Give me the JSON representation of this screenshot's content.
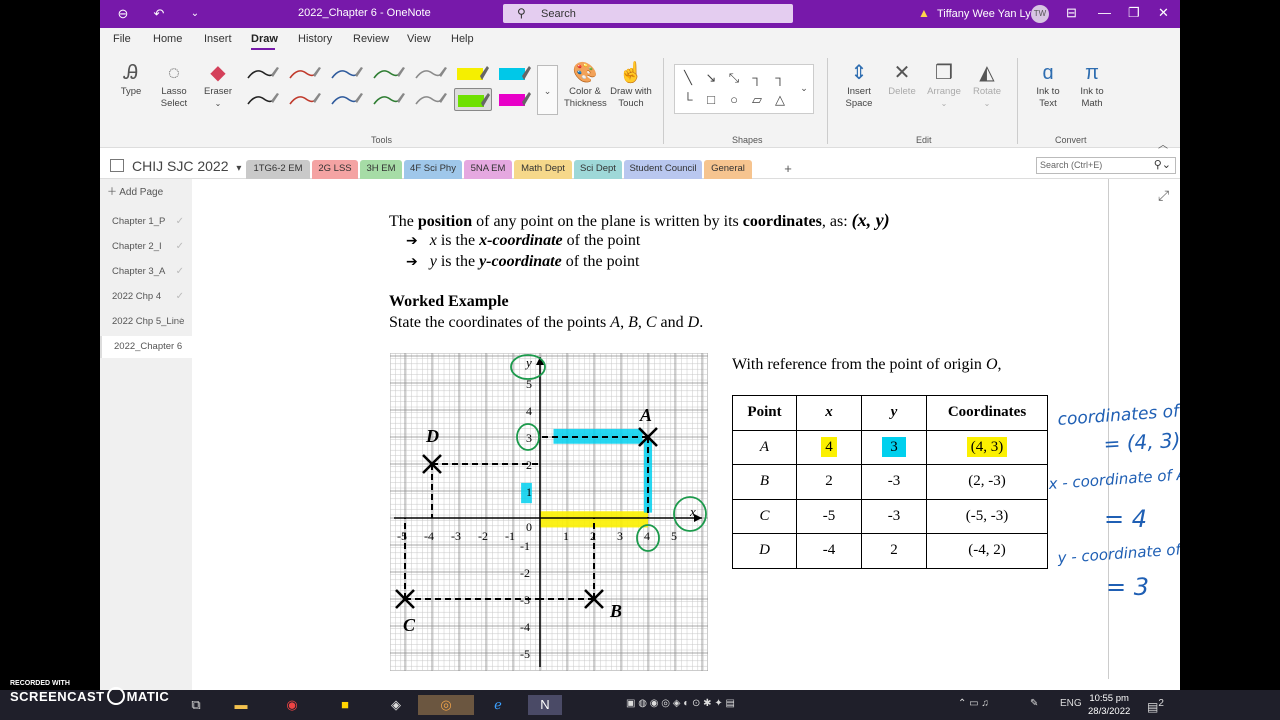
{
  "window": {
    "title": "2022_Chapter 6  -  OneNote",
    "search_placeholder": "Search",
    "user_name": "Tiffany Wee Yan Lyn",
    "user_initials": "TW"
  },
  "menu": [
    "File",
    "Home",
    "Insert",
    "Draw",
    "History",
    "Review",
    "View",
    "Help"
  ],
  "ribbon": {
    "type": "Type",
    "lasso_1": "Lasso",
    "lasso_2": "Select",
    "eraser": "Eraser",
    "color_1": "Color &",
    "color_2": "Thickness",
    "draw_1": "Draw with",
    "draw_2": "Touch",
    "tools_label": "Tools",
    "shapes_label": "Shapes",
    "insert_1": "Insert",
    "insert_2": "Space",
    "delete": "Delete",
    "arrange": "Arrange",
    "rotate": "Rotate",
    "edit_label": "Edit",
    "ink_text_1": "Ink to",
    "ink_text_2": "Text",
    "ink_math_1": "Ink to",
    "ink_math_2": "Math",
    "convert_label": "Convert",
    "pen_colors": [
      "#222222",
      "#c0392b",
      "#2e5a9c",
      "#2e7d32",
      "#8a8a8a",
      "#f5ef00",
      "#00c8e8",
      "#222222",
      "#c0392b",
      "#2e5a9c",
      "#2e7d32",
      "#8a8a8a",
      "#6ee000",
      "#e800c8"
    ]
  },
  "notebook": {
    "name": "CHIJ SJC 2022",
    "tabs": [
      {
        "label": "1TG6-2 EM",
        "color": "#c9c9c9"
      },
      {
        "label": "2G LSS",
        "color": "#f4a3a3"
      },
      {
        "label": "3H EM",
        "color": "#a6dca6"
      },
      {
        "label": "4F Sci Phy",
        "color": "#9fc7ea"
      },
      {
        "label": "5NA EM",
        "color": "#e5a8e0"
      },
      {
        "label": "Math Dept",
        "color": "#f6d88a"
      },
      {
        "label": "Sci Dept",
        "color": "#9ed8d8"
      },
      {
        "label": "Student Council",
        "color": "#b9c7ef"
      },
      {
        "label": "General",
        "color": "#f6c48f"
      }
    ],
    "add_tab": "+",
    "search_placeholder": "Search (Ctrl+E)"
  },
  "pages": {
    "add_page": "Add Page",
    "items": [
      "Chapter 1_P",
      "Chapter 2_I",
      "Chapter 3_A",
      "2022 Chp 4",
      "2022 Chp 5_Line",
      "2022_Chapter 6"
    ]
  },
  "content": {
    "line1_a": "The ",
    "line1_b": "position",
    "line1_c": " of any point on the plane is written by its ",
    "line1_d": "coordinates",
    "line1_e": ", as:  ",
    "line1_f": "(x,  y)",
    "bullet1_a": "x",
    "bullet1_b": " is the ",
    "bullet1_c": "x-coordinate",
    "bullet1_d": " of the point",
    "bullet2_a": "y",
    "bullet2_b": " is the ",
    "bullet2_c": "y-coordinate",
    "bullet2_d": " of the point",
    "worked": "Worked Example",
    "state_a": "State the coordinates of the points ",
    "state_b": "A",
    "state_c": ", ",
    "state_d": "B",
    "state_e": ", ",
    "state_f": "C",
    "state_g": " and ",
    "state_h": "D",
    "state_i": ".",
    "reference_a": "With reference from the point of origin ",
    "reference_b": "O",
    "reference_c": ","
  },
  "table": {
    "headers": [
      "Point",
      "x",
      "y",
      "Coordinates"
    ],
    "rows": [
      [
        "A",
        "4",
        "3",
        "(4, 3)"
      ],
      [
        "B",
        "2",
        "-3",
        "(2, -3)"
      ],
      [
        "C",
        "-5",
        "-3",
        "(-5, -3)"
      ],
      [
        "D",
        "-4",
        "2",
        "(-4, 2)"
      ]
    ]
  },
  "graph": {
    "x_ticks": [
      "-5",
      "-4",
      "-3",
      "-2",
      "-1",
      "1",
      "2",
      "3",
      "4",
      "5"
    ],
    "y_ticks": [
      "5",
      "4",
      "3",
      "2",
      "1",
      "-1",
      "-2",
      "-3",
      "-4",
      "-5"
    ],
    "origin": "0",
    "x_axis": "x",
    "y_axis": "y",
    "points": [
      {
        "label": "A",
        "x": 4,
        "y": 3
      },
      {
        "label": "B",
        "x": 2,
        "y": -3
      },
      {
        "label": "C",
        "x": -5,
        "y": -3
      },
      {
        "label": "D",
        "x": -4,
        "y": 2
      }
    ],
    "hand_circled": [
      "3",
      "1",
      "4",
      "x",
      "y"
    ]
  },
  "handwriting": [
    "coordinates of A",
    "= (4, 3)",
    "x - coordinate of A",
    "= 4",
    "y - coordinate of A",
    "= 3"
  ],
  "taskbar": {
    "lang": "ENG",
    "time": "10:55 pm",
    "date": "28/3/2022",
    "badge": "2"
  },
  "recorder": {
    "line1": "RECORDED WITH",
    "line2a": "SCREENCAST",
    "line2b": "MATIC"
  }
}
